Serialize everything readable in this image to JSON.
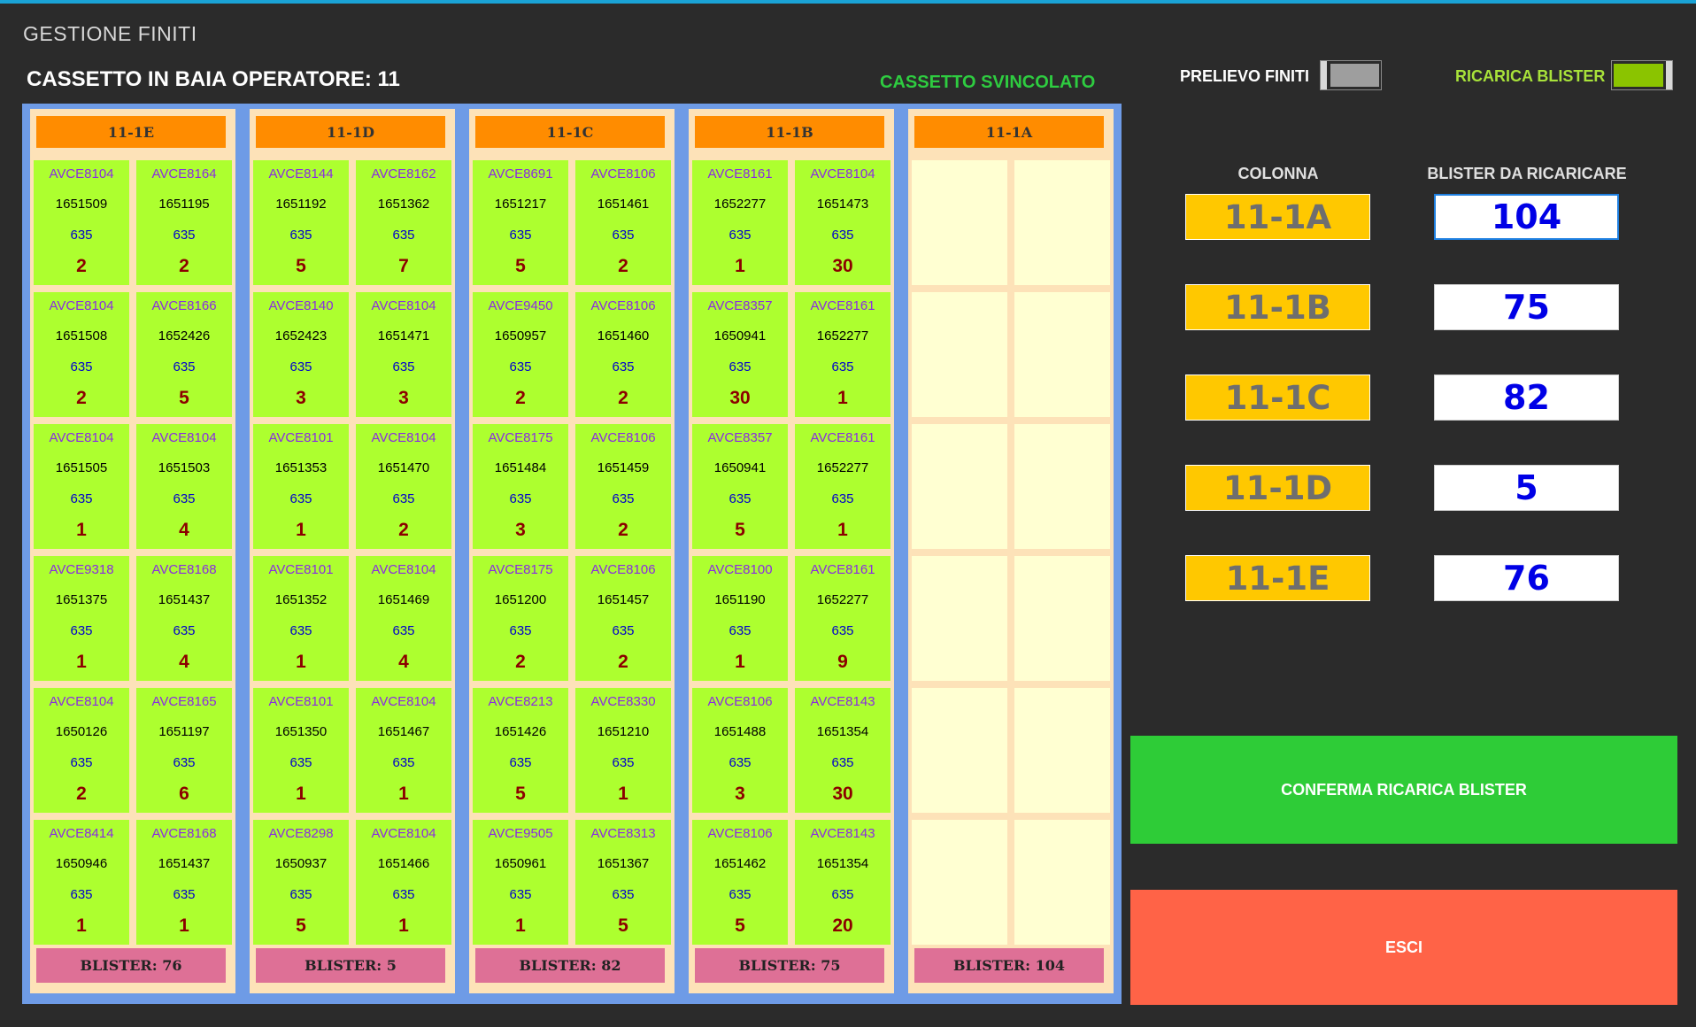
{
  "app": {
    "title": "GESTIONE FINITI",
    "drawer_title": "CASSETTO IN BAIA OPERATORE: 11",
    "drawer_status": "CASSETTO SVINCOLATO"
  },
  "toggles": {
    "prelievo": {
      "label": "PRELIEVO FINITI",
      "on": false,
      "color": "#9e9e9e"
    },
    "ricarica": {
      "label": "RICARICA BLISTER",
      "on": true,
      "color": "#8bc400",
      "label_color": "#a8e23a"
    }
  },
  "columns": [
    {
      "id": "11-1E",
      "blister": "BLISTER: 76",
      "rows": [
        [
          {
            "code": "AVCE8104",
            "lot": "1651509",
            "num": "635",
            "qty": "2"
          },
          {
            "code": "AVCE8164",
            "lot": "1651195",
            "num": "635",
            "qty": "2"
          }
        ],
        [
          {
            "code": "AVCE8104",
            "lot": "1651508",
            "num": "635",
            "qty": "2"
          },
          {
            "code": "AVCE8166",
            "lot": "1652426",
            "num": "635",
            "qty": "5"
          }
        ],
        [
          {
            "code": "AVCE8104",
            "lot": "1651505",
            "num": "635",
            "qty": "1"
          },
          {
            "code": "AVCE8104",
            "lot": "1651503",
            "num": "635",
            "qty": "4"
          }
        ],
        [
          {
            "code": "AVCE9318",
            "lot": "1651375",
            "num": "635",
            "qty": "1"
          },
          {
            "code": "AVCE8168",
            "lot": "1651437",
            "num": "635",
            "qty": "4"
          }
        ],
        [
          {
            "code": "AVCE8104",
            "lot": "1650126",
            "num": "635",
            "qty": "2"
          },
          {
            "code": "AVCE8165",
            "lot": "1651197",
            "num": "635",
            "qty": "6"
          }
        ],
        [
          {
            "code": "AVCE8414",
            "lot": "1650946",
            "num": "635",
            "qty": "1"
          },
          {
            "code": "AVCE8168",
            "lot": "1651437",
            "num": "635",
            "qty": "1"
          }
        ]
      ]
    },
    {
      "id": "11-1D",
      "blister": "BLISTER: 5",
      "rows": [
        [
          {
            "code": "AVCE8144",
            "lot": "1651192",
            "num": "635",
            "qty": "5"
          },
          {
            "code": "AVCE8162",
            "lot": "1651362",
            "num": "635",
            "qty": "7"
          }
        ],
        [
          {
            "code": "AVCE8140",
            "lot": "1652423",
            "num": "635",
            "qty": "3"
          },
          {
            "code": "AVCE8104",
            "lot": "1651471",
            "num": "635",
            "qty": "3"
          }
        ],
        [
          {
            "code": "AVCE8101",
            "lot": "1651353",
            "num": "635",
            "qty": "1"
          },
          {
            "code": "AVCE8104",
            "lot": "1651470",
            "num": "635",
            "qty": "2"
          }
        ],
        [
          {
            "code": "AVCE8101",
            "lot": "1651352",
            "num": "635",
            "qty": "1"
          },
          {
            "code": "AVCE8104",
            "lot": "1651469",
            "num": "635",
            "qty": "4"
          }
        ],
        [
          {
            "code": "AVCE8101",
            "lot": "1651350",
            "num": "635",
            "qty": "1"
          },
          {
            "code": "AVCE8104",
            "lot": "1651467",
            "num": "635",
            "qty": "1"
          }
        ],
        [
          {
            "code": "AVCE8298",
            "lot": "1650937",
            "num": "635",
            "qty": "5"
          },
          {
            "code": "AVCE8104",
            "lot": "1651466",
            "num": "635",
            "qty": "1"
          }
        ]
      ]
    },
    {
      "id": "11-1C",
      "blister": "BLISTER: 82",
      "rows": [
        [
          {
            "code": "AVCE8691",
            "lot": "1651217",
            "num": "635",
            "qty": "5"
          },
          {
            "code": "AVCE8106",
            "lot": "1651461",
            "num": "635",
            "qty": "2"
          }
        ],
        [
          {
            "code": "AVCE9450",
            "lot": "1650957",
            "num": "635",
            "qty": "2"
          },
          {
            "code": "AVCE8106",
            "lot": "1651460",
            "num": "635",
            "qty": "2"
          }
        ],
        [
          {
            "code": "AVCE8175",
            "lot": "1651484",
            "num": "635",
            "qty": "3"
          },
          {
            "code": "AVCE8106",
            "lot": "1651459",
            "num": "635",
            "qty": "2"
          }
        ],
        [
          {
            "code": "AVCE8175",
            "lot": "1651200",
            "num": "635",
            "qty": "2"
          },
          {
            "code": "AVCE8106",
            "lot": "1651457",
            "num": "635",
            "qty": "2"
          }
        ],
        [
          {
            "code": "AVCE8213",
            "lot": "1651426",
            "num": "635",
            "qty": "5"
          },
          {
            "code": "AVCE8330",
            "lot": "1651210",
            "num": "635",
            "qty": "1"
          }
        ],
        [
          {
            "code": "AVCE9505",
            "lot": "1650961",
            "num": "635",
            "qty": "1"
          },
          {
            "code": "AVCE8313",
            "lot": "1651367",
            "num": "635",
            "qty": "5"
          }
        ]
      ]
    },
    {
      "id": "11-1B",
      "blister": "BLISTER: 75",
      "rows": [
        [
          {
            "code": "AVCE8161",
            "lot": "1652277",
            "num": "635",
            "qty": "1"
          },
          {
            "code": "AVCE8104",
            "lot": "1651473",
            "num": "635",
            "qty": "30"
          }
        ],
        [
          {
            "code": "AVCE8357",
            "lot": "1650941",
            "num": "635",
            "qty": "30"
          },
          {
            "code": "AVCE8161",
            "lot": "1652277",
            "num": "635",
            "qty": "1"
          }
        ],
        [
          {
            "code": "AVCE8357",
            "lot": "1650941",
            "num": "635",
            "qty": "5"
          },
          {
            "code": "AVCE8161",
            "lot": "1652277",
            "num": "635",
            "qty": "1"
          }
        ],
        [
          {
            "code": "AVCE8100",
            "lot": "1651190",
            "num": "635",
            "qty": "1"
          },
          {
            "code": "AVCE8161",
            "lot": "1652277",
            "num": "635",
            "qty": "9"
          }
        ],
        [
          {
            "code": "AVCE8106",
            "lot": "1651488",
            "num": "635",
            "qty": "3"
          },
          {
            "code": "AVCE8143",
            "lot": "1651354",
            "num": "635",
            "qty": "30"
          }
        ],
        [
          {
            "code": "AVCE8106",
            "lot": "1651462",
            "num": "635",
            "qty": "5"
          },
          {
            "code": "AVCE8143",
            "lot": "1651354",
            "num": "635",
            "qty": "20"
          }
        ]
      ]
    },
    {
      "id": "11-1A",
      "blister": "BLISTER: 104",
      "rows": [
        [
          null,
          null
        ],
        [
          null,
          null
        ],
        [
          null,
          null
        ],
        [
          null,
          null
        ],
        [
          null,
          null
        ],
        [
          null,
          null
        ]
      ]
    }
  ],
  "panel": {
    "col_header": "COLONNA",
    "blister_header": "BLISTER DA RICARICARE",
    "entries": [
      {
        "column": "11-1A",
        "blister": "104"
      },
      {
        "column": "11-1B",
        "blister": "75"
      },
      {
        "column": "11-1C",
        "blister": "82"
      },
      {
        "column": "11-1D",
        "blister": "5"
      },
      {
        "column": "11-1E",
        "blister": "76"
      }
    ]
  },
  "buttons": {
    "confirm": {
      "label": "CONFERMA RICARICA BLISTER",
      "color": "#2ecc37"
    },
    "exit": {
      "label": "ESCI",
      "color": "#ff6347"
    }
  }
}
